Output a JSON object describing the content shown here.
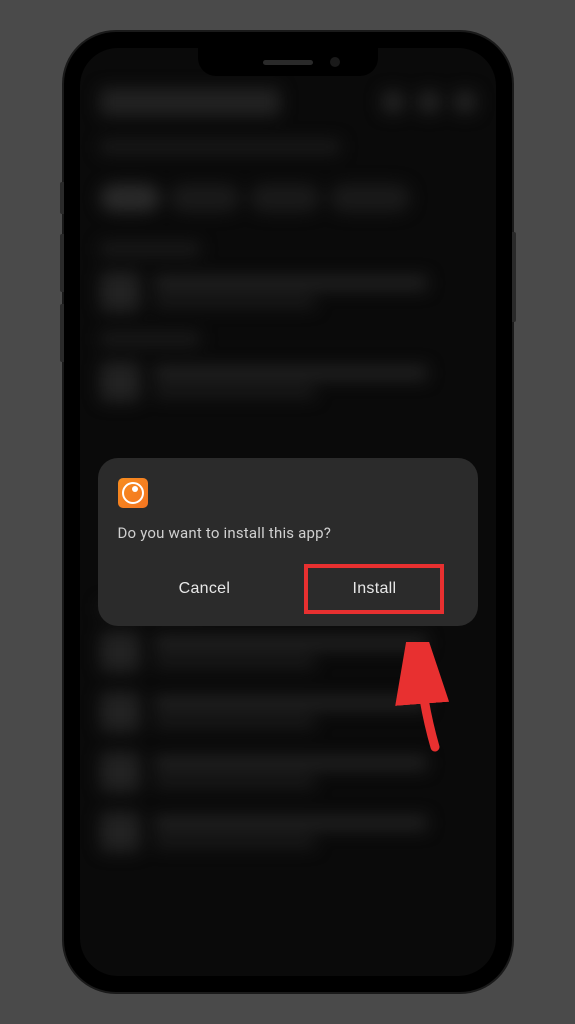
{
  "dialog": {
    "message": "Do you want to install this app?",
    "cancel_label": "Cancel",
    "install_label": "Install",
    "app_icon_name": "crunchyroll-icon"
  },
  "annotation": {
    "highlight_target": "install-button",
    "arrow_color": "#e83030"
  }
}
